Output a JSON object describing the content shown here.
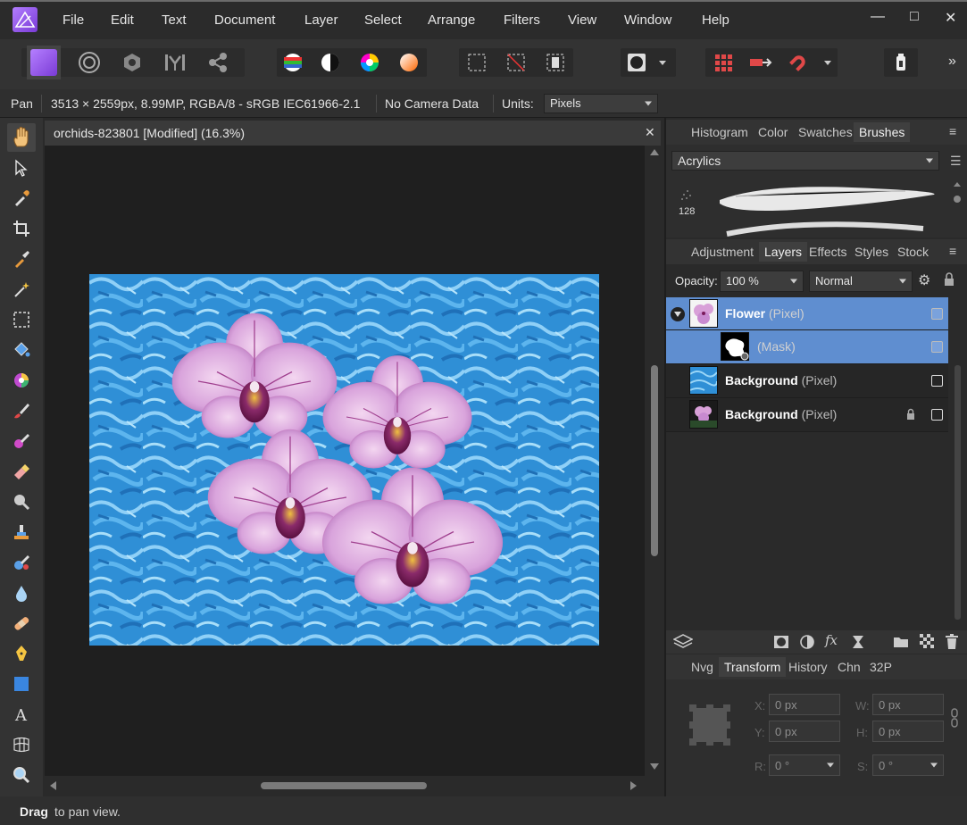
{
  "menubar": {
    "items": [
      "File",
      "Edit",
      "Text",
      "Document",
      "Layer",
      "Select",
      "Arrange",
      "Filters",
      "View",
      "Window",
      "Help"
    ],
    "window_controls": [
      "—",
      "□",
      "✕"
    ]
  },
  "toolbar": {
    "personas": [
      "photo-persona",
      "liquify-persona",
      "develop-persona",
      "tone-mapping-persona",
      "export-persona"
    ],
    "overflow": "»"
  },
  "contextbar": {
    "tool": "Pan",
    "info": "3513 × 2559px, 8.99MP, RGBA/8 - sRGB IEC61966-2.1",
    "camera": "No Camera Data",
    "units_label": "Units:",
    "units_value": "Pixels"
  },
  "document": {
    "tab_title": "orchids-823801 [Modified] (16.3%)",
    "close": "✕"
  },
  "status": {
    "bold": "Drag",
    "text": "to pan view."
  },
  "panels": {
    "top_tabs": [
      "Histogram",
      "Color",
      "Swatches",
      "Brushes"
    ],
    "top_active": "Brushes",
    "brush_category": "Acrylics",
    "brush_size": "128",
    "mid_tabs": [
      "Adjustment",
      "Layers",
      "Effects",
      "Styles",
      "Stock"
    ],
    "mid_active": "Layers",
    "opacity_label": "Opacity:",
    "opacity_value": "100 %",
    "blend_mode": "Normal",
    "bottom_tabs": [
      "Nvg",
      "Transform",
      "History",
      "Chn",
      "32P"
    ],
    "bottom_active": "Transform"
  },
  "layers": [
    {
      "name": "Flower",
      "type": "(Pixel)",
      "selected": true,
      "expanded": true,
      "locked": false,
      "visible": true
    },
    {
      "name": "",
      "type": "(Mask)",
      "selected": true,
      "child": true,
      "visible": true
    },
    {
      "name": "Background",
      "type": "(Pixel)",
      "selected": false,
      "locked": false,
      "visible": true
    },
    {
      "name": "Background",
      "type": "(Pixel)",
      "selected": false,
      "locked": true,
      "visible": true
    }
  ],
  "transform": {
    "x_label": "X:",
    "x": "0 px",
    "y_label": "Y:",
    "y": "0 px",
    "w_label": "W:",
    "w": "0 px",
    "h_label": "H:",
    "h": "0 px",
    "r_label": "R:",
    "r": "0 °",
    "s_label": "S:",
    "s": "0 °"
  },
  "colors": {
    "accent": "#5f8ed0",
    "canvas_bg": "#1f1f1f",
    "photo_blue": "#3ba0e0",
    "orchid": "#d8a8e0"
  }
}
